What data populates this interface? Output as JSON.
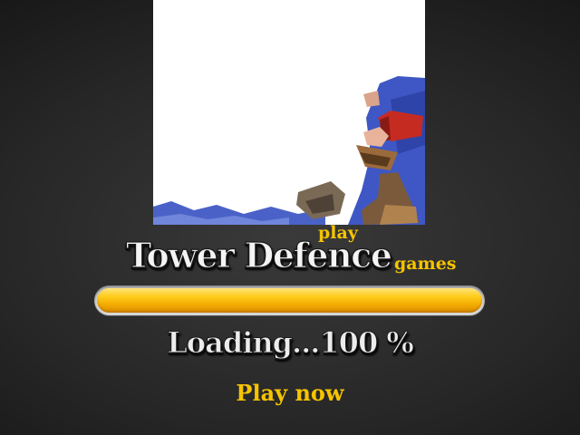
{
  "logo": {
    "main_text": "Tower Defence",
    "play_text": "play",
    "games_text": "games"
  },
  "loading": {
    "label": "Loading...",
    "percent_text": "100 %",
    "progress_fraction": 1.0
  },
  "play_now_label": "Play now",
  "colors": {
    "accent_yellow": "#f5c400",
    "bar_fill": "#ffcc1a",
    "background": "#262626",
    "banner_sky": "#3f57c4"
  }
}
